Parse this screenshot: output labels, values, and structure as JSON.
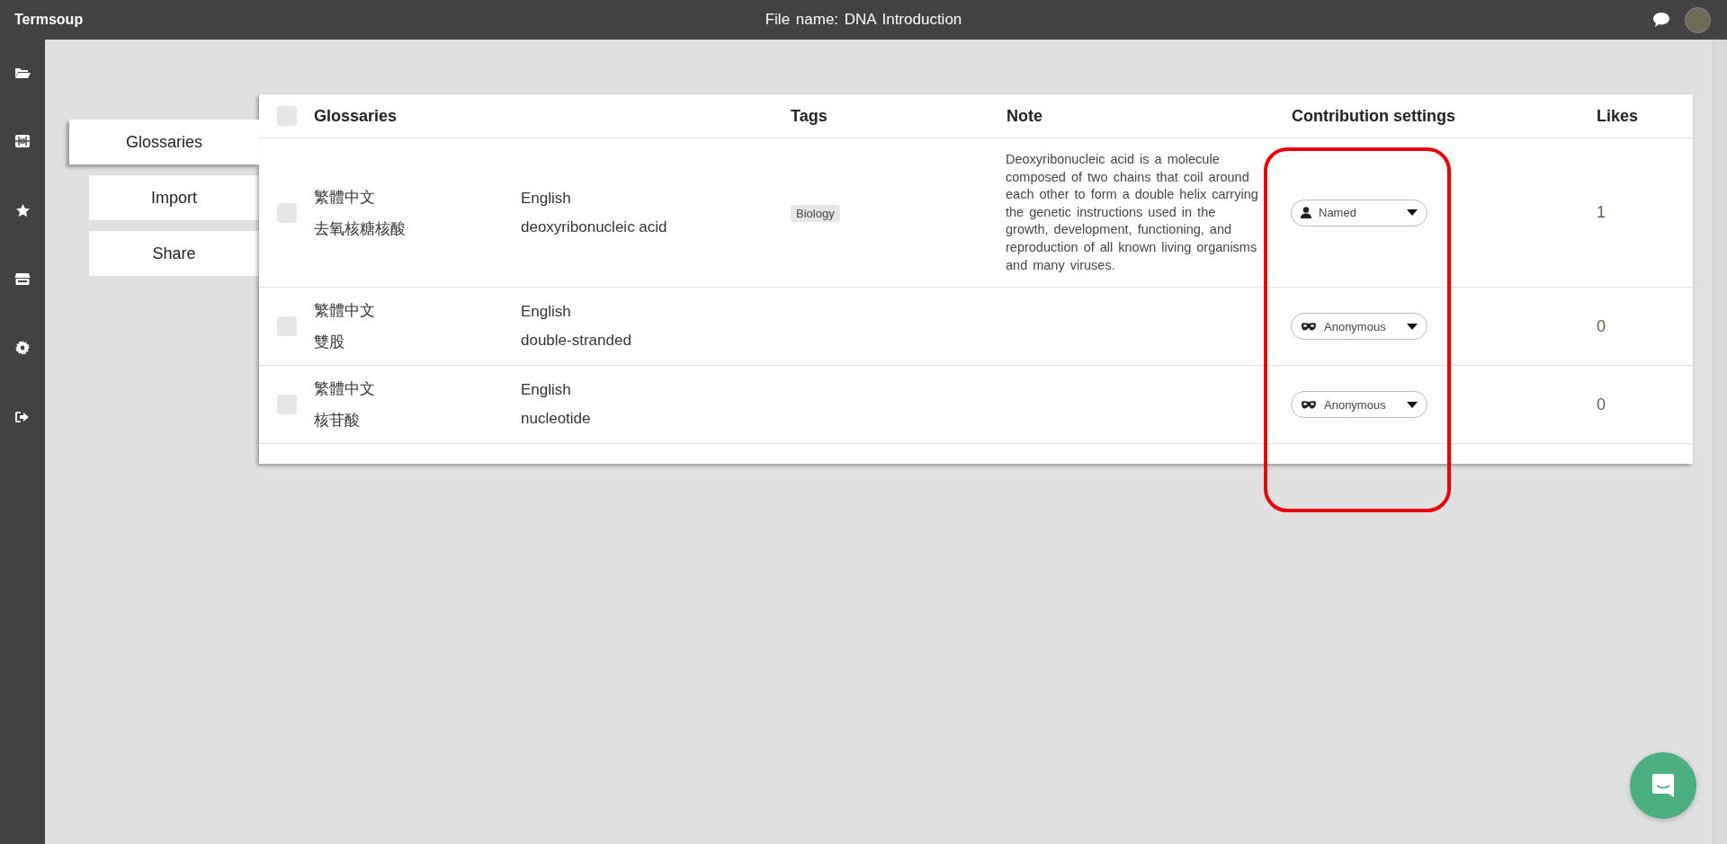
{
  "app": {
    "name": "Termsoup"
  },
  "file_title": "File name: DNA Introduction",
  "tabs": [
    {
      "label": "Glossaries",
      "selected": true
    },
    {
      "label": "Import",
      "selected": false
    },
    {
      "label": "Share",
      "selected": false
    }
  ],
  "table": {
    "select_all": {
      "checked": false
    },
    "columns": [
      "Glossaries",
      "Tags",
      "Note",
      "Contribution settings",
      "Likes"
    ],
    "rows": [
      {
        "checked": false,
        "source_language": "繁體中文",
        "source_term": "去氧核糖核酸",
        "target_language": "English",
        "target_term": "deoxyribonucleic  acid",
        "tags": [
          "Biology"
        ],
        "note": "Deoxyribonucleic acid is a molecule composed of two chains that coil around each other to form a double helix carrying the genetic instructions used in the growth, development, functioning, and reproduction of all known living organisms and many viruses.",
        "contribution": {
          "kind": "named",
          "label": "Named"
        },
        "likes": "1"
      },
      {
        "checked": false,
        "source_language": "繁體中文",
        "source_term": "雙股",
        "target_language": "English",
        "target_term": "double-stranded",
        "tags": [],
        "contribution": {
          "kind": "anonymous",
          "label": "Anonymous"
        },
        "likes": "0"
      },
      {
        "checked": false,
        "source_language": "繁體中文",
        "source_term": "核苷酸",
        "target_language": "English",
        "target_term": "nucleotide",
        "tags": [],
        "contribution": {
          "kind": "anonymous",
          "label": "Anonymous"
        },
        "likes": "0"
      }
    ]
  }
}
